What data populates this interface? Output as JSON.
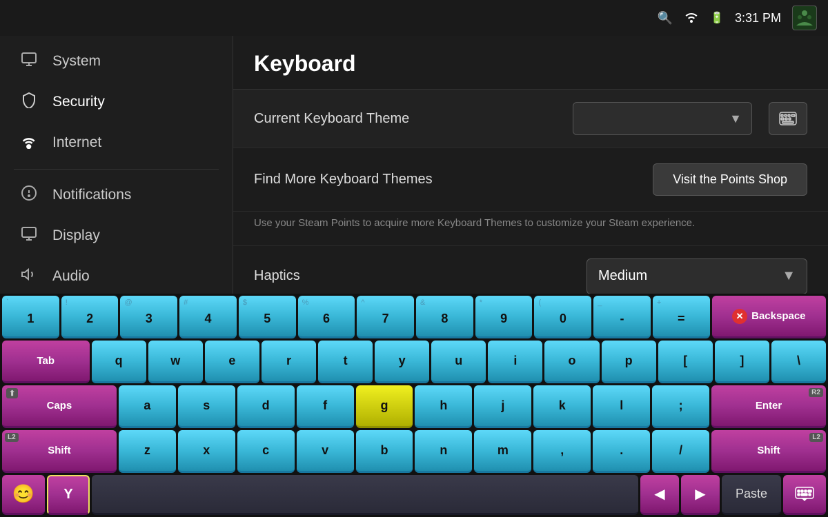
{
  "statusBar": {
    "time": "3:31 PM",
    "searchIcon": "🔍",
    "wifiIcon": "📡",
    "batteryIcon": "🔋"
  },
  "sidebar": {
    "items": [
      {
        "id": "system",
        "label": "System",
        "icon": "🖥"
      },
      {
        "id": "security",
        "label": "Security",
        "icon": "🔒"
      },
      {
        "id": "internet",
        "label": "Internet",
        "icon": "📶"
      },
      {
        "id": "notifications",
        "label": "Notifications",
        "icon": "⚠"
      },
      {
        "id": "display",
        "label": "Display",
        "icon": "🖥"
      },
      {
        "id": "audio",
        "label": "Audio",
        "icon": "🔈"
      }
    ]
  },
  "main": {
    "pageTitle": "Keyboard",
    "keyboardTheme": {
      "label": "Current Keyboard Theme",
      "value": "",
      "placeholder": ""
    },
    "findMore": {
      "label": "Find More Keyboard Themes",
      "buttonLabel": "Visit the Points Shop"
    },
    "description": "Use your Steam Points to acquire more Keyboard Themes to customize your Steam experience.",
    "haptics": {
      "label": "Haptics",
      "value": "Medium"
    }
  },
  "keyboard": {
    "row1": [
      "1",
      "2",
      "3",
      "4",
      "5",
      "6",
      "7",
      "8",
      "9",
      "0",
      "-",
      "="
    ],
    "row1sub": [
      "`",
      "!",
      "@",
      "#",
      "$",
      "%",
      "^",
      "&",
      "*",
      "(",
      "_",
      "+"
    ],
    "row2": [
      "q",
      "w",
      "e",
      "r",
      "t",
      "y",
      "u",
      "i",
      "o",
      "p",
      "[",
      "]",
      "\\"
    ],
    "row3": [
      "a",
      "s",
      "d",
      "f",
      "g",
      "h",
      "j",
      "k",
      "l",
      ";"
    ],
    "row4": [
      "z",
      "x",
      "c",
      "v",
      "b",
      "n",
      "m",
      ",",
      ".",
      "/"
    ],
    "modifiers": {
      "tab": "Tab",
      "caps": "Caps",
      "shift": "Shift",
      "backspace": "Backspace",
      "enter": "Enter"
    },
    "bottomRow": {
      "emoji": "😊",
      "y": "Y",
      "paste": "Paste"
    }
  }
}
